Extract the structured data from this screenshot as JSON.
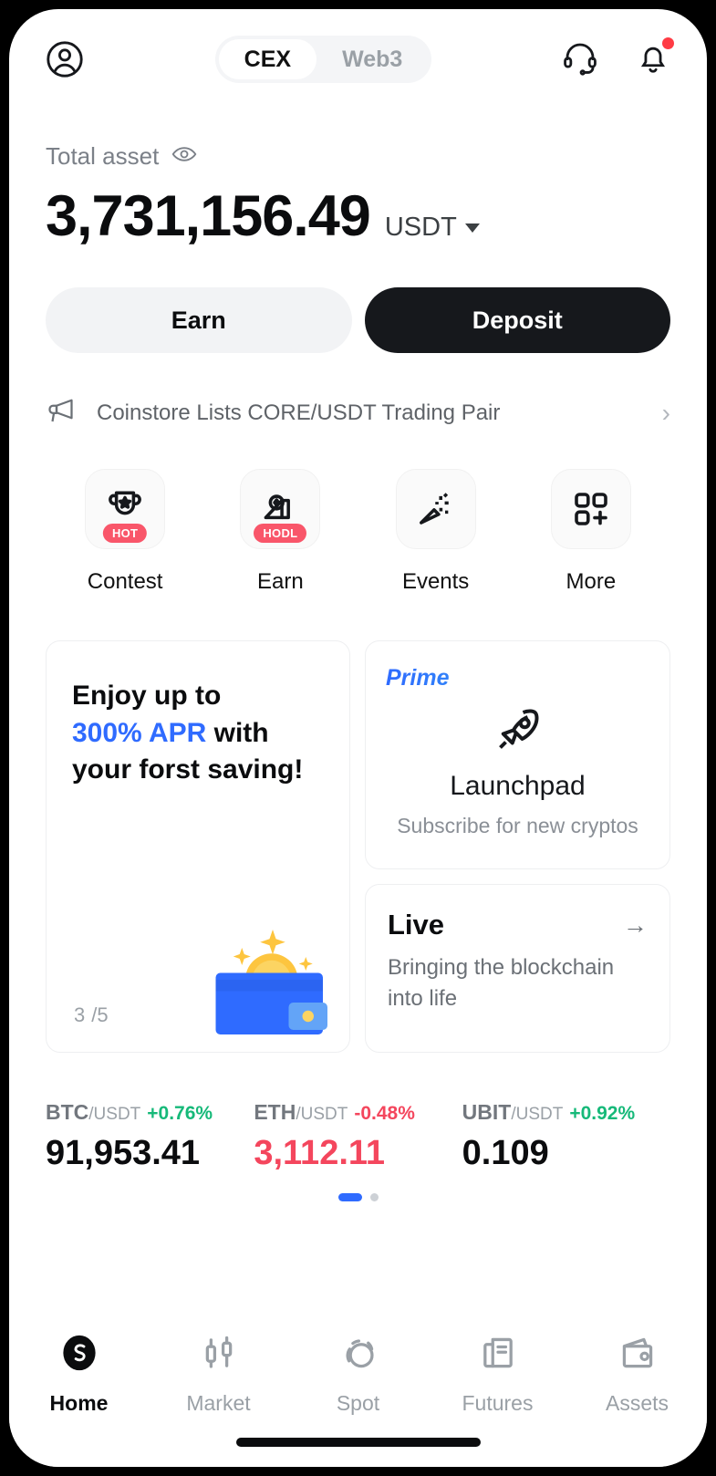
{
  "header": {
    "avatar_icon": "user-circle-icon",
    "tabs": [
      {
        "label": "CEX",
        "active": true
      },
      {
        "label": "Web3",
        "active": false
      }
    ],
    "support_icon": "headset-icon",
    "notification_icon": "bell-icon",
    "notification_badge": true
  },
  "balance": {
    "label": "Total asset",
    "eye_icon": "eye-icon",
    "amount": "3,731,156.49",
    "currency": "USDT",
    "currency_caret_icon": "chevron-down-icon"
  },
  "actions": {
    "earn_label": "Earn",
    "deposit_label": "Deposit"
  },
  "announcement": {
    "icon": "megaphone-icon",
    "text": "Coinstore Lists CORE/USDT Trading Pair",
    "chevron": "›"
  },
  "quick_actions": [
    {
      "label": "Contest",
      "icon": "trophy-icon",
      "badge": "HOT"
    },
    {
      "label": "Earn",
      "icon": "piggy-hand-icon",
      "badge": "HODL"
    },
    {
      "label": "Events",
      "icon": "party-popper-icon",
      "badge": ""
    },
    {
      "label": "More",
      "icon": "grid-plus-icon",
      "badge": ""
    }
  ],
  "promo_card": {
    "line1": "Enjoy up to",
    "accent": "300% APR",
    "line2_tail": " with",
    "line3": "your forst saving!",
    "counter_current": "3",
    "counter_total": "/5",
    "art_icon": "wallet-bitcoin-icon"
  },
  "launchpad_card": {
    "tag": "Prime",
    "icon": "rocket-icon",
    "title": "Launchpad",
    "subtitle": "Subscribe for new cryptos"
  },
  "live_card": {
    "title": "Live",
    "arrow_icon": "arrow-right-icon",
    "subtitle": "Bringing the blockchain into life"
  },
  "tickers": [
    {
      "symbol": "BTC",
      "quote": "/USDT",
      "change": "+0.76%",
      "direction": "up",
      "price": "91,953.41"
    },
    {
      "symbol": "ETH",
      "quote": "/USDT",
      "change": "-0.48%",
      "direction": "down",
      "price": "3,112.11"
    },
    {
      "symbol": "UBIT",
      "quote": "/USDT",
      "change": "+0.92%",
      "direction": "up",
      "price": "0.109"
    }
  ],
  "carousel": {
    "pages": 2,
    "active_index": 0
  },
  "bottom_nav": [
    {
      "label": "Home",
      "icon": "coinstore-logo-icon",
      "active": true
    },
    {
      "label": "Market",
      "icon": "candlestick-icon",
      "active": false
    },
    {
      "label": "Spot",
      "icon": "spot-swap-icon",
      "active": false
    },
    {
      "label": "Futures",
      "icon": "futures-doc-icon",
      "active": false
    },
    {
      "label": "Assets",
      "icon": "wallet-icon",
      "active": false
    }
  ],
  "colors": {
    "accent_blue": "#2f6bff",
    "up_green": "#16b979",
    "down_red": "#f4465d",
    "badge_red": "#f9566a",
    "dark": "#16181c"
  }
}
